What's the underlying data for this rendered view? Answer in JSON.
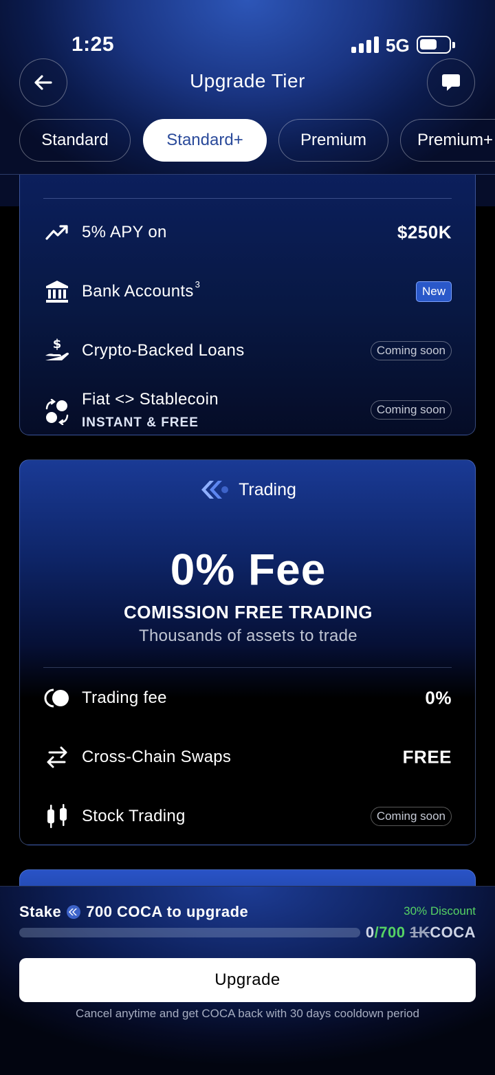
{
  "status_bar": {
    "time": "1:25",
    "network": "5G"
  },
  "header": {
    "title": "Upgrade Tier"
  },
  "tabs": [
    {
      "label": "Standard",
      "active": false
    },
    {
      "label": "Standard+",
      "active": true
    },
    {
      "label": "Premium",
      "active": false
    },
    {
      "label": "Premium+",
      "active": false
    }
  ],
  "banking": {
    "rows": [
      {
        "icon": "trending-up-icon",
        "label": "5% APY on",
        "value": "$250K"
      },
      {
        "icon": "bank-icon",
        "label": "Bank Accounts",
        "sup": "3",
        "badge": "New"
      },
      {
        "icon": "hand-dollar-icon",
        "label": "Crypto-Backed Loans",
        "badge": "Coming soon"
      },
      {
        "icon": "exchange-icon",
        "label": "Fiat <> Stablecoin",
        "sub": "INSTANT & FREE",
        "badge": "Coming soon"
      }
    ]
  },
  "trading": {
    "title": "Trading",
    "headline": "0% Fee",
    "caps": "COMISSION FREE TRADING",
    "desc": "Thousands of assets to trade",
    "rows": [
      {
        "icon": "fee-icon",
        "label": "Trading fee",
        "value": "0%"
      },
      {
        "icon": "swap-icon",
        "label": "Cross-Chain Swaps",
        "value": "FREE"
      },
      {
        "icon": "candlestick-icon",
        "label": "Stock Trading",
        "badge": "Coming soon"
      }
    ]
  },
  "stake": {
    "prefix": "Stake",
    "amount": "700 COCA to upgrade",
    "discount": "30% Discount",
    "progress_current": "0",
    "progress_target": "/700",
    "progress_old": "1K",
    "progress_unit": "COCA",
    "progress_fraction": 0,
    "button": "Upgrade",
    "footnote": "Cancel anytime and get COCA back with 30 days cooldown period"
  },
  "colors": {
    "accent_blue": "#2a58c9",
    "green": "#56d364",
    "tab_active_text": "#2a4a9a"
  }
}
